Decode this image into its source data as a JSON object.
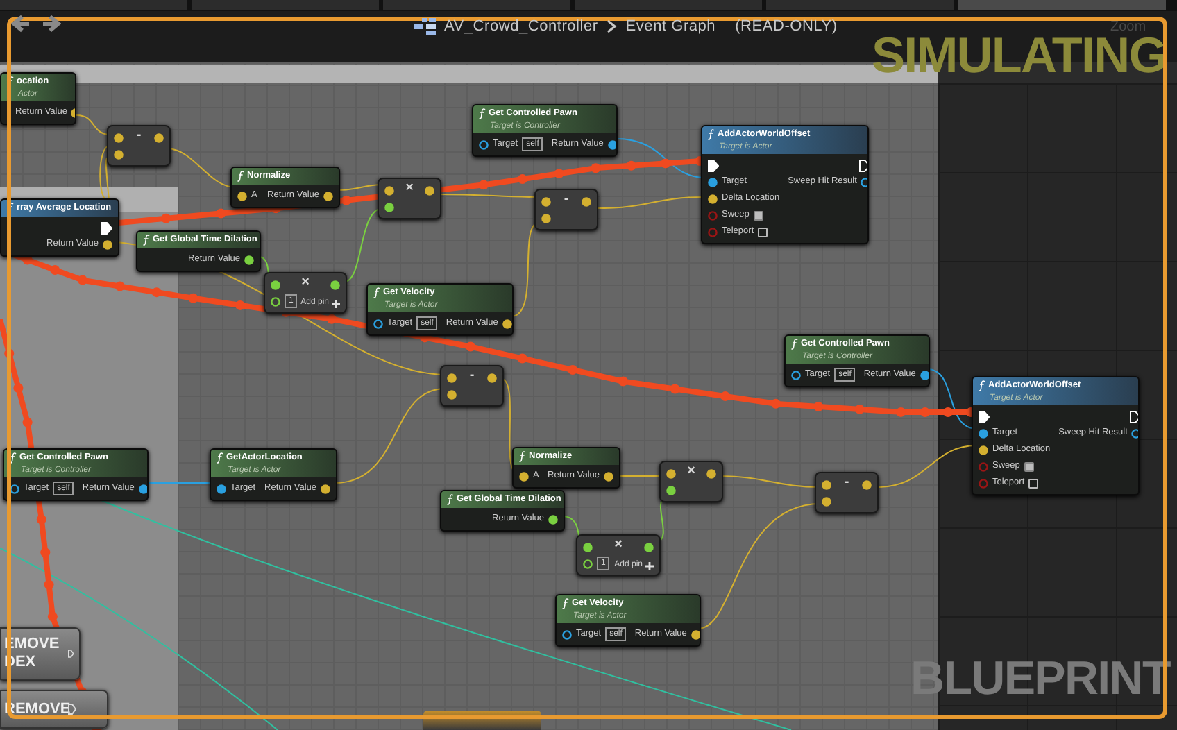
{
  "tabs": [
    {
      "selected": false
    },
    {
      "selected": false
    },
    {
      "selected": false
    },
    {
      "selected": false
    },
    {
      "selected": false
    },
    {
      "selected": true
    }
  ],
  "header": {
    "title": "AV_Crowd_Controller",
    "breadcrumb": "Event Graph",
    "mode": "(READ-ONLY)",
    "zoom": "Zoom"
  },
  "overlays": {
    "top": "SIMULATING",
    "bottom": "BLUEPRINT"
  },
  "nodes": [
    {
      "kind": "pure",
      "title": "ocation",
      "subtitle": "Actor",
      "outputs": [
        {
          "label": "Return Value",
          "kind": "vector",
          "connected": true
        }
      ]
    },
    {
      "kind": "operator",
      "symbol": "-",
      "inputs": [
        {
          "kind": "vector",
          "connected": true
        },
        {
          "kind": "vector",
          "connected": true
        }
      ],
      "outputs": [
        {
          "kind": "vector",
          "connected": true
        }
      ]
    },
    {
      "kind": "pure",
      "title": "Get Controlled Pawn",
      "subtitle": "Target is Controller",
      "inputs": [
        {
          "label": "Target",
          "kind": "object",
          "connected": false,
          "default": "self"
        }
      ],
      "outputs": [
        {
          "label": "Return Value",
          "kind": "object",
          "connected": true
        }
      ]
    },
    {
      "kind": "impure",
      "title": "AddActorWorldOffset",
      "subtitle": "Target is Actor",
      "inputs": [
        {
          "kind": "exec",
          "connected": true
        },
        {
          "label": "Target",
          "kind": "object",
          "connected": true
        },
        {
          "label": "Delta Location",
          "kind": "vector",
          "connected": true
        },
        {
          "label": "Sweep",
          "kind": "bool",
          "connected": false,
          "checked": true
        },
        {
          "label": "Teleport",
          "kind": "bool",
          "connected": false,
          "checked": false
        }
      ],
      "outputs": [
        {
          "kind": "exec",
          "connected": false
        },
        {
          "label": "Sweep Hit Result",
          "kind": "object",
          "connected": false
        }
      ]
    },
    {
      "kind": "impure",
      "title": "rray Average Location",
      "outputs": [
        {
          "kind": "exec",
          "connected": true
        },
        {
          "label": "Return Value",
          "kind": "vector",
          "connected": true
        }
      ]
    },
    {
      "kind": "pure",
      "title": "Get Global Time Dilation",
      "outputs": [
        {
          "label": "Return Value",
          "kind": "float",
          "connected": true
        }
      ]
    },
    {
      "kind": "pure",
      "title": "Normalize",
      "inputs": [
        {
          "label": "A",
          "kind": "vector",
          "connected": true
        }
      ],
      "outputs": [
        {
          "label": "Return Value",
          "kind": "vector",
          "connected": true
        }
      ]
    },
    {
      "kind": "operator",
      "symbol": "×",
      "inputs": [
        {
          "kind": "vector",
          "connected": true
        },
        {
          "kind": "float",
          "connected": true
        }
      ],
      "outputs": [
        {
          "kind": "vector",
          "connected": true
        }
      ]
    },
    {
      "kind": "operator",
      "symbol": "-",
      "inputs": [
        {
          "kind": "vector",
          "connected": true
        },
        {
          "kind": "vector",
          "connected": true
        }
      ],
      "outputs": [
        {
          "kind": "vector",
          "connected": true
        }
      ]
    },
    {
      "kind": "operator",
      "symbol": "×",
      "add_pin": "Add pin",
      "inputs": [
        {
          "kind": "float",
          "connected": true
        },
        {
          "kind": "float",
          "connected": false,
          "default": "1"
        }
      ],
      "outputs": [
        {
          "kind": "float",
          "connected": true
        }
      ]
    },
    {
      "kind": "pure",
      "title": "Get Velocity",
      "subtitle": "Target is Actor",
      "inputs": [
        {
          "label": "Target",
          "kind": "object",
          "connected": false,
          "default": "self"
        }
      ],
      "outputs": [
        {
          "label": "Return Value",
          "kind": "vector",
          "connected": true
        }
      ]
    },
    {
      "kind": "operator",
      "symbol": "-",
      "inputs": [
        {
          "kind": "vector",
          "connected": true
        },
        {
          "kind": "vector",
          "connected": true
        }
      ],
      "outputs": [
        {
          "kind": "vector",
          "connected": true
        }
      ]
    },
    {
      "kind": "pure",
      "title": "Get Controlled Pawn",
      "subtitle": "Target is Controller",
      "inputs": [
        {
          "label": "Target",
          "kind": "object",
          "connected": false,
          "default": "self"
        }
      ],
      "outputs": [
        {
          "label": "Return Value",
          "kind": "object",
          "connected": true
        }
      ]
    },
    {
      "kind": "impure",
      "title": "AddActorWorldOffset",
      "subtitle": "Target is Actor",
      "inputs": [
        {
          "kind": "exec",
          "connected": true
        },
        {
          "label": "Target",
          "kind": "object",
          "connected": true
        },
        {
          "label": "Delta Location",
          "kind": "vector",
          "connected": true
        },
        {
          "label": "Sweep",
          "kind": "bool",
          "connected": false,
          "checked": true
        },
        {
          "label": "Teleport",
          "kind": "bool",
          "connected": false,
          "checked": false
        }
      ],
      "outputs": [
        {
          "kind": "exec",
          "connected": false
        },
        {
          "label": "Sweep Hit Result",
          "kind": "object",
          "connected": false
        }
      ]
    },
    {
      "kind": "pure",
      "title": "Get Controlled Pawn",
      "subtitle": "Target is Controller",
      "inputs": [
        {
          "label": "Target",
          "kind": "object",
          "connected": false,
          "default": "self"
        }
      ],
      "outputs": [
        {
          "label": "Return Value",
          "kind": "object",
          "connected": true
        }
      ]
    },
    {
      "kind": "pure",
      "title": "GetActorLocation",
      "subtitle": "Target is Actor",
      "inputs": [
        {
          "label": "Target",
          "kind": "object",
          "connected": true
        }
      ],
      "outputs": [
        {
          "label": "Return Value",
          "kind": "vector",
          "connected": true
        }
      ]
    },
    {
      "kind": "pure",
      "title": "Normalize",
      "inputs": [
        {
          "label": "A",
          "kind": "vector",
          "connected": true
        }
      ],
      "outputs": [
        {
          "label": "Return Value",
          "kind": "vector",
          "connected": true
        }
      ]
    },
    {
      "kind": "pure",
      "title": "Get Global Time Dilation",
      "outputs": [
        {
          "label": "Return Value",
          "kind": "float",
          "connected": true
        }
      ]
    },
    {
      "kind": "operator",
      "symbol": "×",
      "add_pin": "Add pin",
      "inputs": [
        {
          "kind": "float",
          "connected": true
        },
        {
          "kind": "float",
          "connected": false,
          "default": "1"
        }
      ],
      "outputs": [
        {
          "kind": "float",
          "connected": true
        }
      ]
    },
    {
      "kind": "operator",
      "symbol": "×",
      "inputs": [
        {
          "kind": "vector",
          "connected": true
        },
        {
          "kind": "float",
          "connected": true
        }
      ],
      "outputs": [
        {
          "kind": "vector",
          "connected": true
        }
      ]
    },
    {
      "kind": "operator",
      "symbol": "-",
      "inputs": [
        {
          "kind": "vector",
          "connected": true
        },
        {
          "kind": "vector",
          "connected": true
        }
      ],
      "outputs": [
        {
          "kind": "vector",
          "connected": true
        }
      ]
    },
    {
      "kind": "pure",
      "title": "Get Velocity",
      "subtitle": "Target is Actor",
      "inputs": [
        {
          "label": "Target",
          "kind": "object",
          "connected": false,
          "default": "self"
        }
      ],
      "outputs": [
        {
          "label": "Return Value",
          "kind": "vector",
          "connected": true
        }
      ]
    }
  ],
  "side_buttons": [
    {
      "label": "EMOVE DEX"
    },
    {
      "label": "REMOVE"
    }
  ]
}
